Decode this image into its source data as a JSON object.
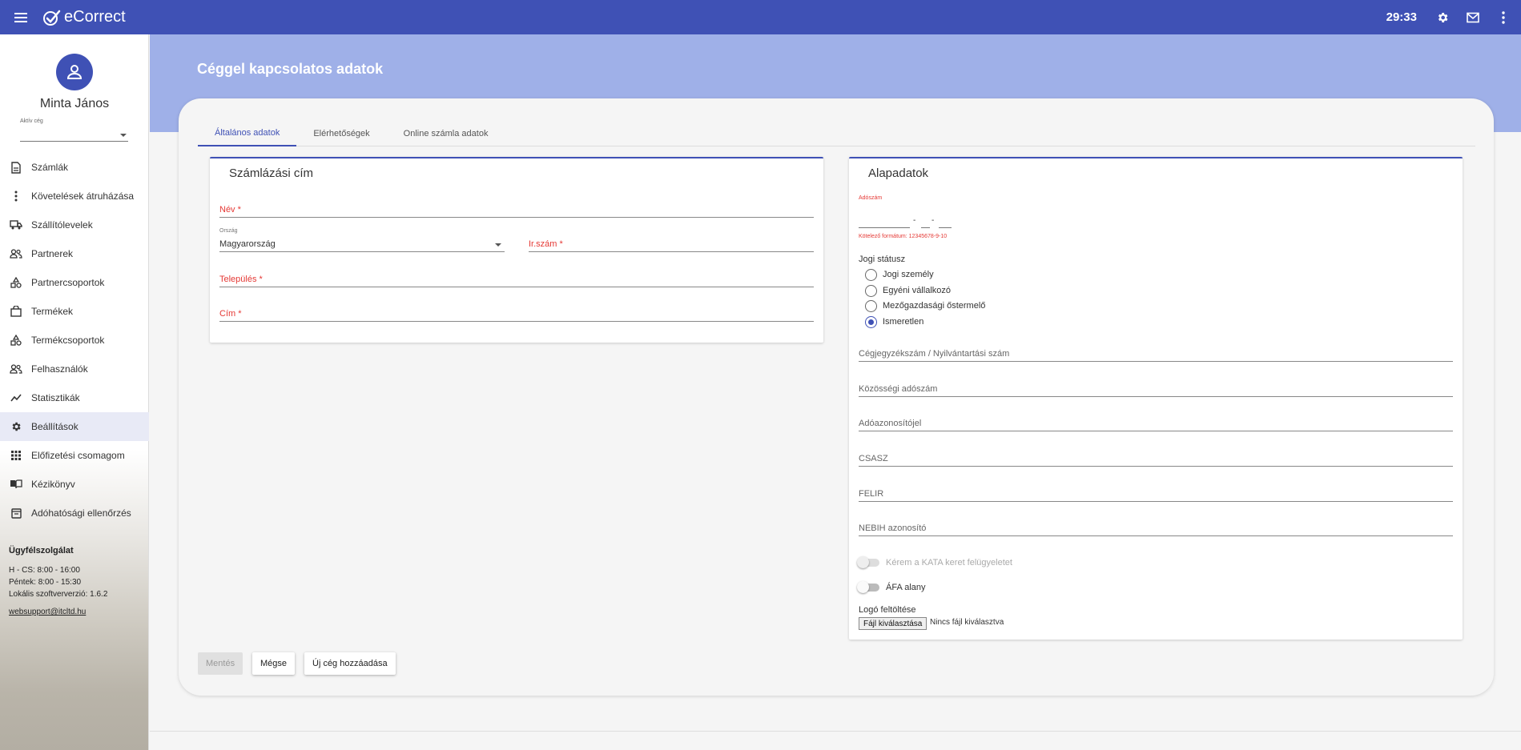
{
  "topbar": {
    "app_name": "eCorrect",
    "timer": "29:33",
    "icons": [
      "menu-icon",
      "settings-icon",
      "mail-icon",
      "more-vert-icon"
    ]
  },
  "sidebar": {
    "user_name": "Minta János",
    "company_label": "Aktív cég",
    "company_value": "",
    "items": [
      {
        "label": "Számlák",
        "icon": "document-icon"
      },
      {
        "label": "Követelések átruházása",
        "icon": "more-vert-icon"
      },
      {
        "label": "Szállítólevelek",
        "icon": "truck-icon"
      },
      {
        "label": "Partnerek",
        "icon": "people-icon"
      },
      {
        "label": "Partnercsoportok",
        "icon": "category-icon"
      },
      {
        "label": "Termékek",
        "icon": "shopping-bag-icon"
      },
      {
        "label": "Termékcsoportok",
        "icon": "category-icon"
      },
      {
        "label": "Felhasználók",
        "icon": "people-icon"
      },
      {
        "label": "Statisztikák",
        "icon": "trending-icon"
      },
      {
        "label": "Beállítások",
        "icon": "settings-icon",
        "active": true
      },
      {
        "label": "Előfizetési csomagom",
        "icon": "apps-icon"
      },
      {
        "label": "Kézikönyv",
        "icon": "book-icon"
      },
      {
        "label": "Adóhatósági ellenőrzés",
        "icon": "archive-icon"
      }
    ],
    "support": {
      "title": "Ügyfélszolgálat",
      "hours_1": "H - CS: 8:00 - 16:00",
      "hours_2": "Péntek: 8:00 - 15:30",
      "version": "Lokális szoftververzió: 1.6.2",
      "email": "websupport@itcltd.hu"
    }
  },
  "page": {
    "title": "Céggel kapcsolatos adatok",
    "tabs": [
      "Általános adatok",
      "Elérhetőségek",
      "Online számla adatok"
    ],
    "active_tab": 0
  },
  "billing": {
    "title": "Számlázási cím",
    "name_label": "Név *",
    "country_label": "Ország",
    "country_value": "Magyarország",
    "zip_label": "Ir.szám *",
    "city_label": "Település *",
    "address_label": "Cím *"
  },
  "basic": {
    "title": "Alapadatok",
    "tax_label": "Adószám",
    "tax_sep_1": "-",
    "tax_sep_2": "-",
    "tax_hint": "Kötelező formátum: 12345678-9-10",
    "legal_status_label": "Jogi státusz",
    "legal_options": [
      "Jogi személy",
      "Egyéni vállalkozó",
      "Mezőgazdasági őstermelő",
      "Ismeretlen"
    ],
    "legal_selected": 3,
    "reg_number_label": "Cégjegyzékszám / Nyilvántartási szám",
    "eu_tax_label": "Közösségi adószám",
    "tax_id_label": "Adóazonosítójel",
    "csasz_label": "CSASZ",
    "felir_label": "FELIR",
    "nebih_label": "NEBIH azonosító",
    "kata_label": "Kérem a KATA keret felügyeletet",
    "kata_on": false,
    "vat_label": "ÁFA alany",
    "vat_on": false,
    "logo_label": "Logó feltöltése",
    "file_button": "Fájl kiválasztása",
    "file_status": "Nincs fájl kiválasztva"
  },
  "actions": {
    "save": "Mentés",
    "cancel": "Mégse",
    "add_company": "Új cég hozzáadása"
  },
  "colors": {
    "primary": "#3f51b5",
    "hero": "#9fb0e8",
    "required": "#e53935"
  }
}
